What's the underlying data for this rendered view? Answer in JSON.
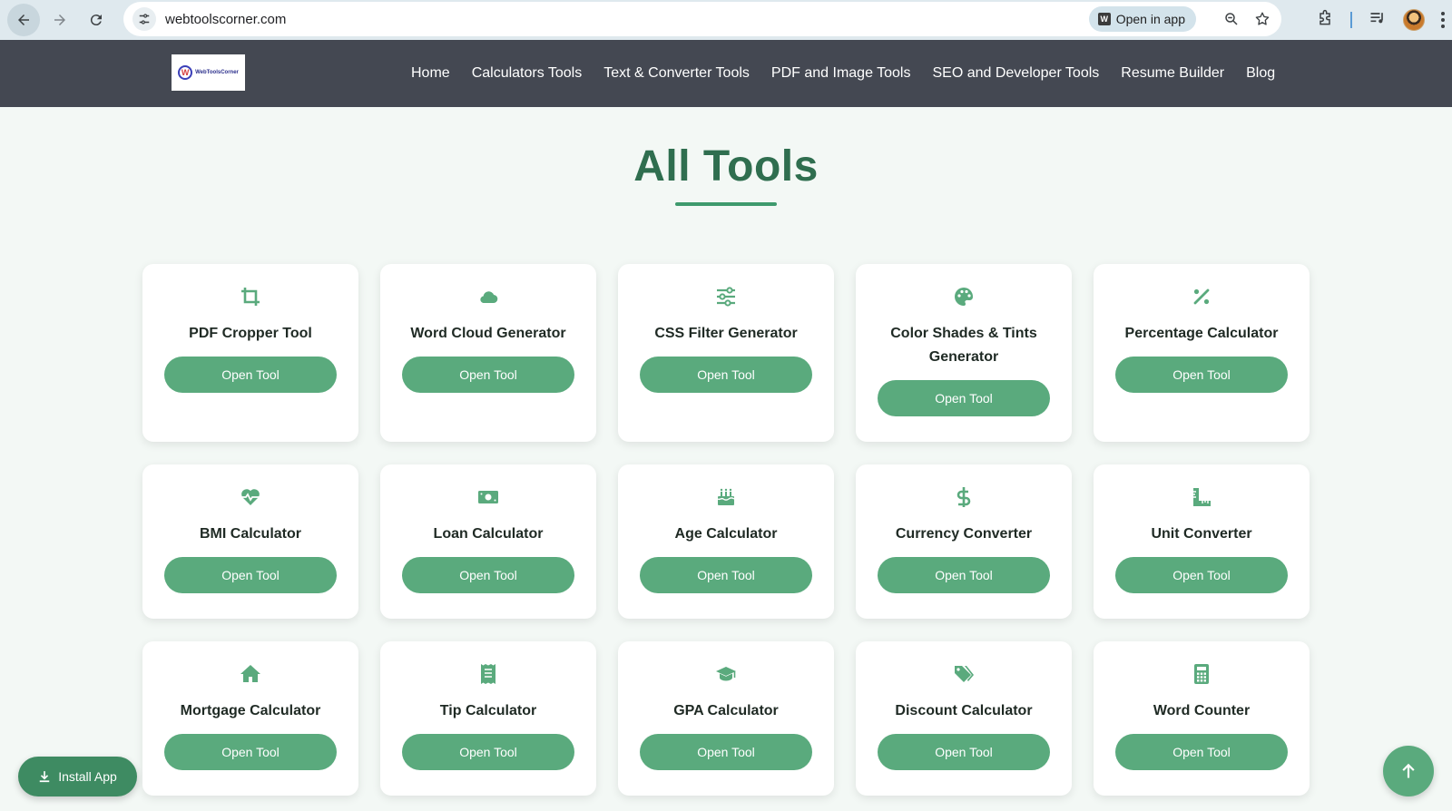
{
  "browser": {
    "url": "webtoolscorner.com",
    "open_in_app_label": "Open in app",
    "open_in_app_badge": "W"
  },
  "site": {
    "logo_text": "WebToolsCorner",
    "logo_mark": "W",
    "menu": [
      {
        "label": "Home"
      },
      {
        "label": "Calculators Tools"
      },
      {
        "label": "Text & Converter Tools"
      },
      {
        "label": "PDF and Image Tools"
      },
      {
        "label": "SEO and Developer Tools"
      },
      {
        "label": "Resume Builder"
      },
      {
        "label": "Blog"
      }
    ]
  },
  "page": {
    "title": "All Tools"
  },
  "colors": {
    "accent": "#5aaa7d",
    "title": "#2f6e4f",
    "header_bg": "#444852"
  },
  "tools": [
    {
      "name": "PDF Cropper Tool",
      "icon": "crop-icon",
      "button": "Open Tool"
    },
    {
      "name": "Word Cloud Generator",
      "icon": "cloud-icon",
      "button": "Open Tool"
    },
    {
      "name": "CSS Filter Generator",
      "icon": "sliders-icon",
      "button": "Open Tool"
    },
    {
      "name": "Color Shades & Tints Generator",
      "icon": "palette-icon",
      "button": "Open Tool"
    },
    {
      "name": "Percentage Calculator",
      "icon": "percent-icon",
      "button": "Open Tool"
    },
    {
      "name": "BMI Calculator",
      "icon": "heartbeat-icon",
      "button": "Open Tool"
    },
    {
      "name": "Loan Calculator",
      "icon": "money-bill-icon",
      "button": "Open Tool"
    },
    {
      "name": "Age Calculator",
      "icon": "birthday-cake-icon",
      "button": "Open Tool"
    },
    {
      "name": "Currency Converter",
      "icon": "dollar-icon",
      "button": "Open Tool"
    },
    {
      "name": "Unit Converter",
      "icon": "ruler-icon",
      "button": "Open Tool"
    },
    {
      "name": "Mortgage Calculator",
      "icon": "home-icon",
      "button": "Open Tool"
    },
    {
      "name": "Tip Calculator",
      "icon": "receipt-icon",
      "button": "Open Tool"
    },
    {
      "name": "GPA Calculator",
      "icon": "graduation-cap-icon",
      "button": "Open Tool"
    },
    {
      "name": "Discount Calculator",
      "icon": "tags-icon",
      "button": "Open Tool"
    },
    {
      "name": "Word Counter",
      "icon": "calculator-icon",
      "button": "Open Tool"
    }
  ],
  "floating": {
    "install_label": "Install App"
  }
}
